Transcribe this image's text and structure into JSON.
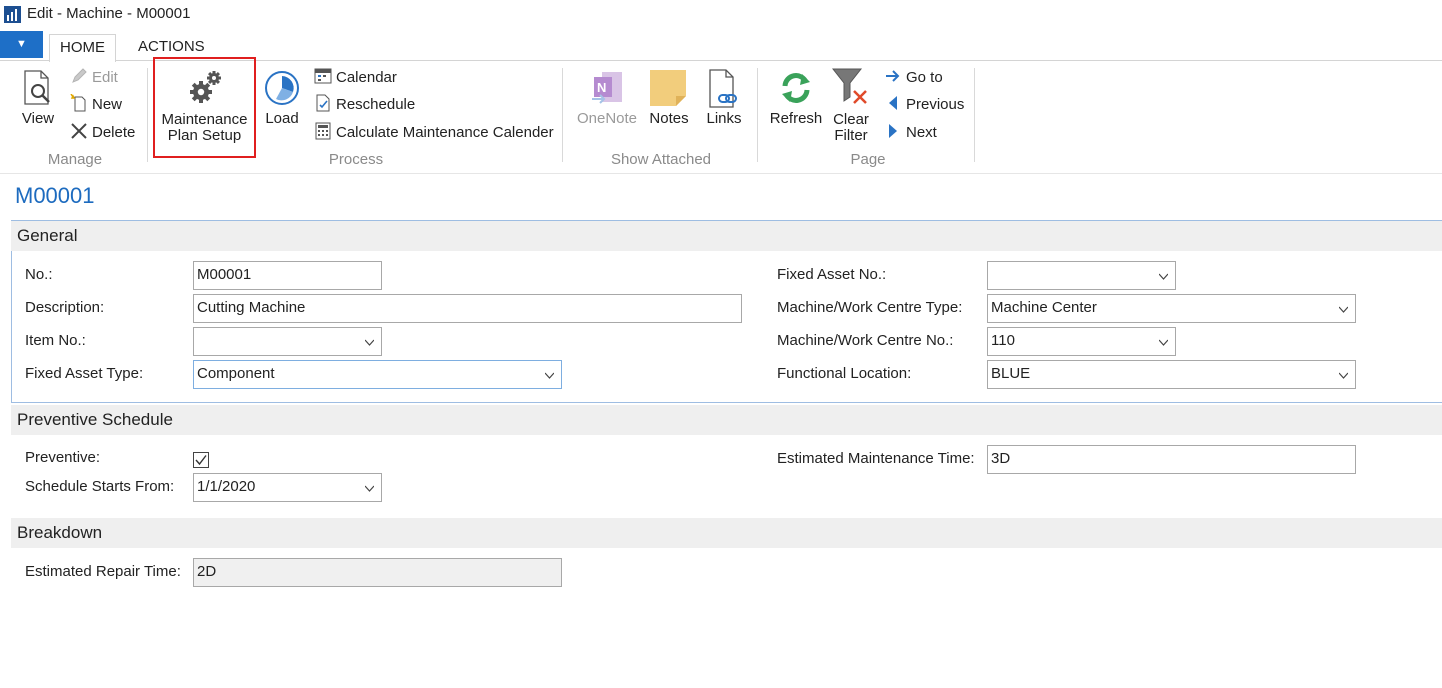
{
  "window": {
    "title": "Edit - Machine - M00001"
  },
  "menu": {
    "button_label": "▼"
  },
  "tabs": [
    {
      "label": "HOME"
    },
    {
      "label": "ACTIONS"
    }
  ],
  "ribbon": {
    "manage": {
      "label": "Manage",
      "view": "View",
      "edit": "Edit",
      "new": "New",
      "delete": "Delete"
    },
    "process": {
      "label": "Process",
      "maintenance_plan_setup_line1": "Maintenance",
      "maintenance_plan_setup_line2": "Plan Setup",
      "load": "Load",
      "calendar": "Calendar",
      "reschedule": "Reschedule",
      "calculate": "Calculate Maintenance Calender"
    },
    "show_attached": {
      "label": "Show Attached",
      "onenote": "OneNote",
      "notes": "Notes",
      "links": "Links"
    },
    "page": {
      "label": "Page",
      "refresh": "Refresh",
      "clear_filter_line1": "Clear",
      "clear_filter_line2": "Filter",
      "go_to": "Go to",
      "previous": "Previous",
      "next": "Next"
    }
  },
  "page": {
    "title": "M00001"
  },
  "general": {
    "header": "General",
    "no_label": "No.:",
    "no_value": "M00001",
    "description_label": "Description:",
    "description_value": "Cutting Machine",
    "item_no_label": "Item No.:",
    "item_no_value": "",
    "fixed_asset_type_label": "Fixed Asset Type:",
    "fixed_asset_type_value": "Component",
    "fixed_asset_no_label": "Fixed Asset No.:",
    "fixed_asset_no_value": "",
    "mwc_type_label": "Machine/Work Centre Type:",
    "mwc_type_value": "Machine Center",
    "mwc_no_label": "Machine/Work Centre No.:",
    "mwc_no_value": "110",
    "functional_location_label": "Functional Location:",
    "functional_location_value": "BLUE"
  },
  "preventive": {
    "header": "Preventive Schedule",
    "preventive_label": "Preventive:",
    "preventive_checked": true,
    "schedule_label": "Schedule Starts From:",
    "schedule_value": "1/1/2020",
    "est_maint_label": "Estimated Maintenance Time:",
    "est_maint_value": "3D"
  },
  "breakdown": {
    "header": "Breakdown",
    "est_repair_label": "Estimated Repair Time:",
    "est_repair_value": "2D"
  }
}
